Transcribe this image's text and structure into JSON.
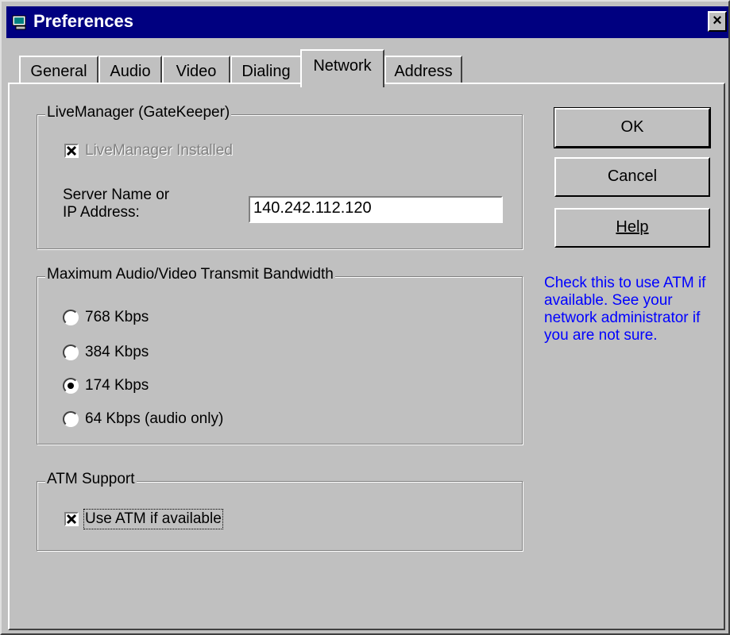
{
  "window": {
    "title": "Preferences",
    "close_glyph": "×"
  },
  "tabs": [
    {
      "label": "General"
    },
    {
      "label": "Audio"
    },
    {
      "label": "Video"
    },
    {
      "label": "Dialing"
    },
    {
      "label": "Network",
      "active": true
    },
    {
      "label": "Address"
    }
  ],
  "livemanager": {
    "group_label": "LiveManager (GateKeeper)",
    "installed_label": "LiveManager Installed",
    "installed_checked": true,
    "server_label_line1": "Server Name or",
    "server_label_line2": "IP Address:",
    "server_value": "140.242.112.120"
  },
  "bandwidth": {
    "group_label": "Maximum Audio/Video Transmit Bandwidth",
    "options": [
      {
        "label": "768 Kbps",
        "selected": false
      },
      {
        "label": "384 Kbps",
        "selected": false
      },
      {
        "label": "174 Kbps",
        "selected": true
      },
      {
        "label": "64 Kbps (audio only)",
        "selected": false
      }
    ]
  },
  "atm": {
    "group_label": "ATM Support",
    "use_label": "Use ATM if available",
    "use_checked": true
  },
  "buttons": {
    "ok": "OK",
    "cancel": "Cancel",
    "help": "Help"
  },
  "hint": "Check this to use ATM if available.  See your network administrator if you are not sure.",
  "colors": {
    "titlebar": "#000080",
    "face": "#c0c0c0",
    "hint_text": "#0000ff"
  },
  "icons": {
    "app": "preferences-app-icon",
    "close": "close-icon",
    "check": "checkmark-icon"
  }
}
